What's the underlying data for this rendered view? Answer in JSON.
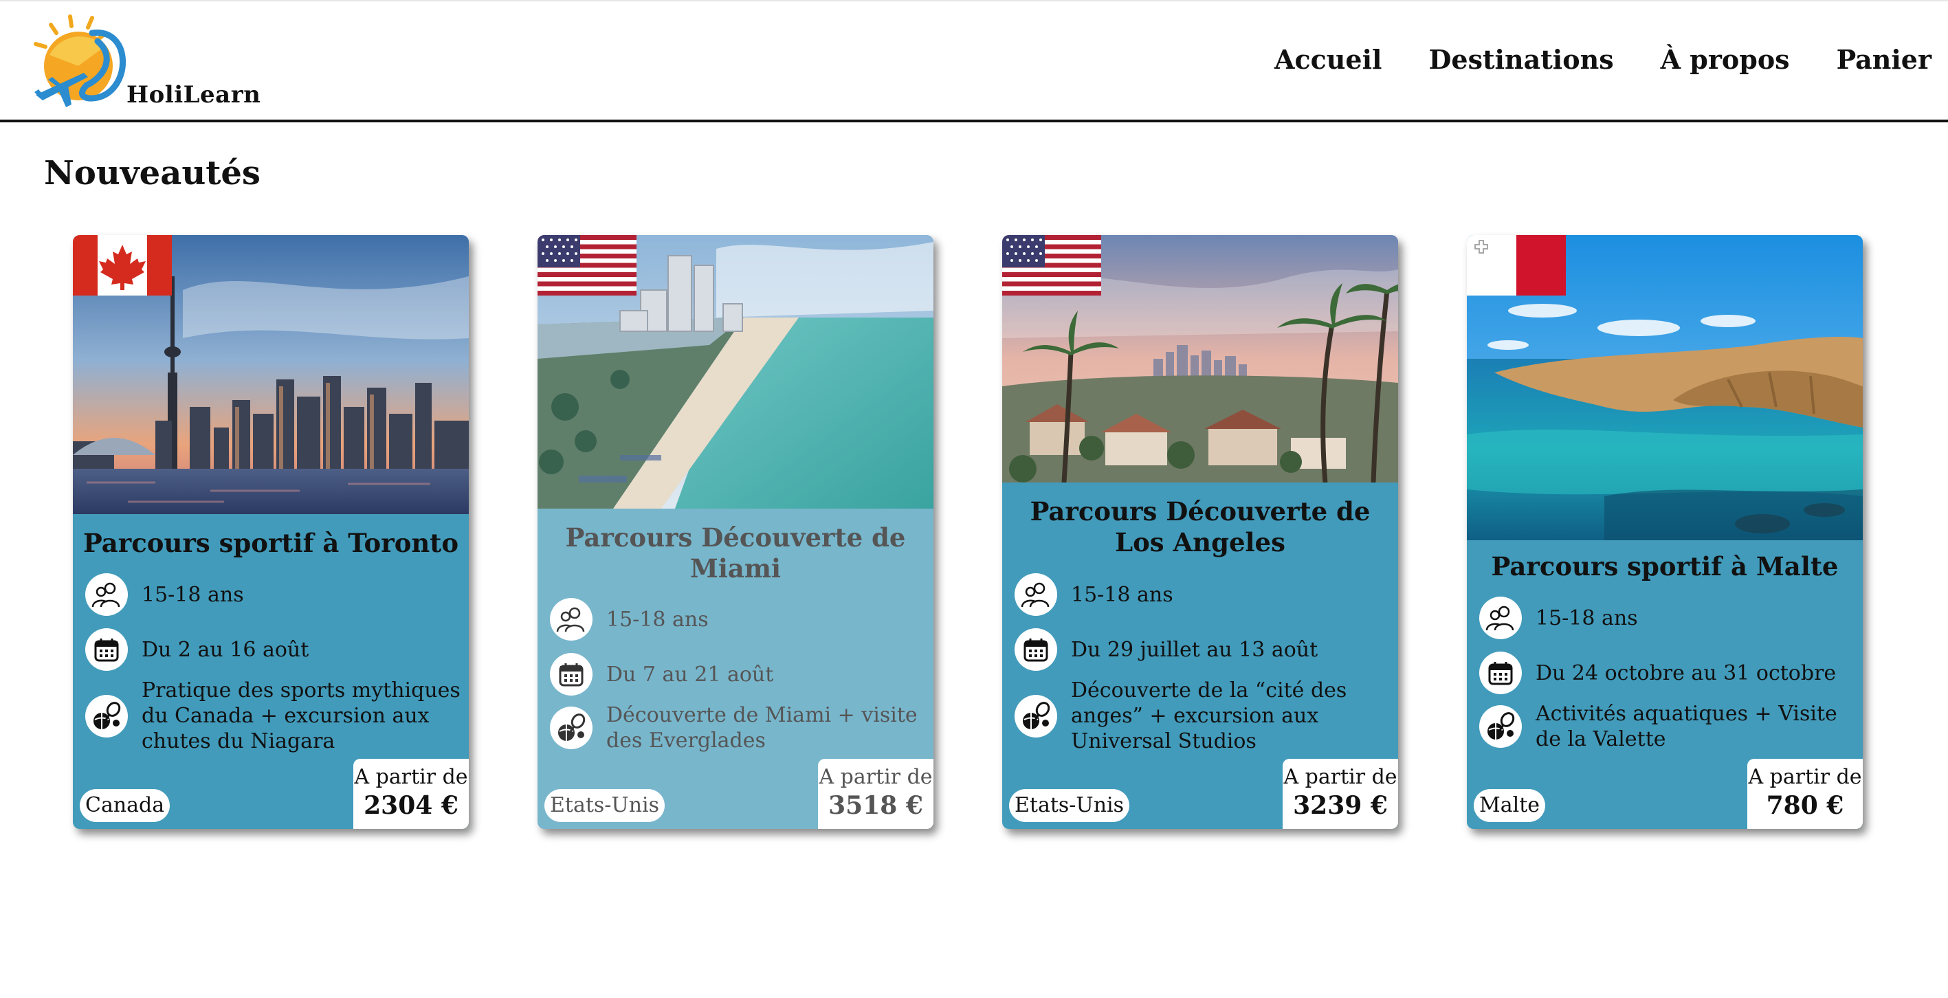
{
  "brand": {
    "name": "HoliLearn"
  },
  "nav": [
    "Accueil",
    "Destinations",
    "À propos",
    "Panier"
  ],
  "section_title": "Nouveautés",
  "price_prefix": "A partir de",
  "colors": {
    "card_blue": "#429bbb",
    "card_faded": "#78b6cc",
    "text": "#111111"
  },
  "cards": [
    {
      "title": "Parcours sportif à Toronto",
      "flag_icon": "canada-flag-icon",
      "age": "15-18 ans",
      "dates": "Du 2 au 16 août",
      "activities": "Pratique des sports mythiques du Canada + excursion aux chutes du Niagara",
      "country": "Canada",
      "price": "2304 €"
    },
    {
      "title": "Parcours Découverte de Miami",
      "flag_icon": "usa-flag-icon",
      "age": "15-18 ans",
      "dates": "Du 7 au 21 août",
      "activities": "Découverte de Miami + visite des Everglades",
      "country": "Etats-Unis",
      "price": "3518 €"
    },
    {
      "title": "Parcours Découverte de Los Angeles",
      "flag_icon": "usa-flag-icon",
      "age": "15-18 ans",
      "dates": "Du 29 juillet au 13 août",
      "activities": "Découverte de la “cité des anges” + excursion aux Universal Studios",
      "country": "Etats-Unis",
      "price": "3239 €"
    },
    {
      "title": "Parcours sportif à Malte",
      "flag_icon": "malta-flag-icon",
      "age": "15-18 ans",
      "dates": "Du 24 octobre au 31 octobre",
      "activities": "Activités aquatiques + Visite de la Valette",
      "country": "Malte",
      "price": "780 €"
    }
  ]
}
